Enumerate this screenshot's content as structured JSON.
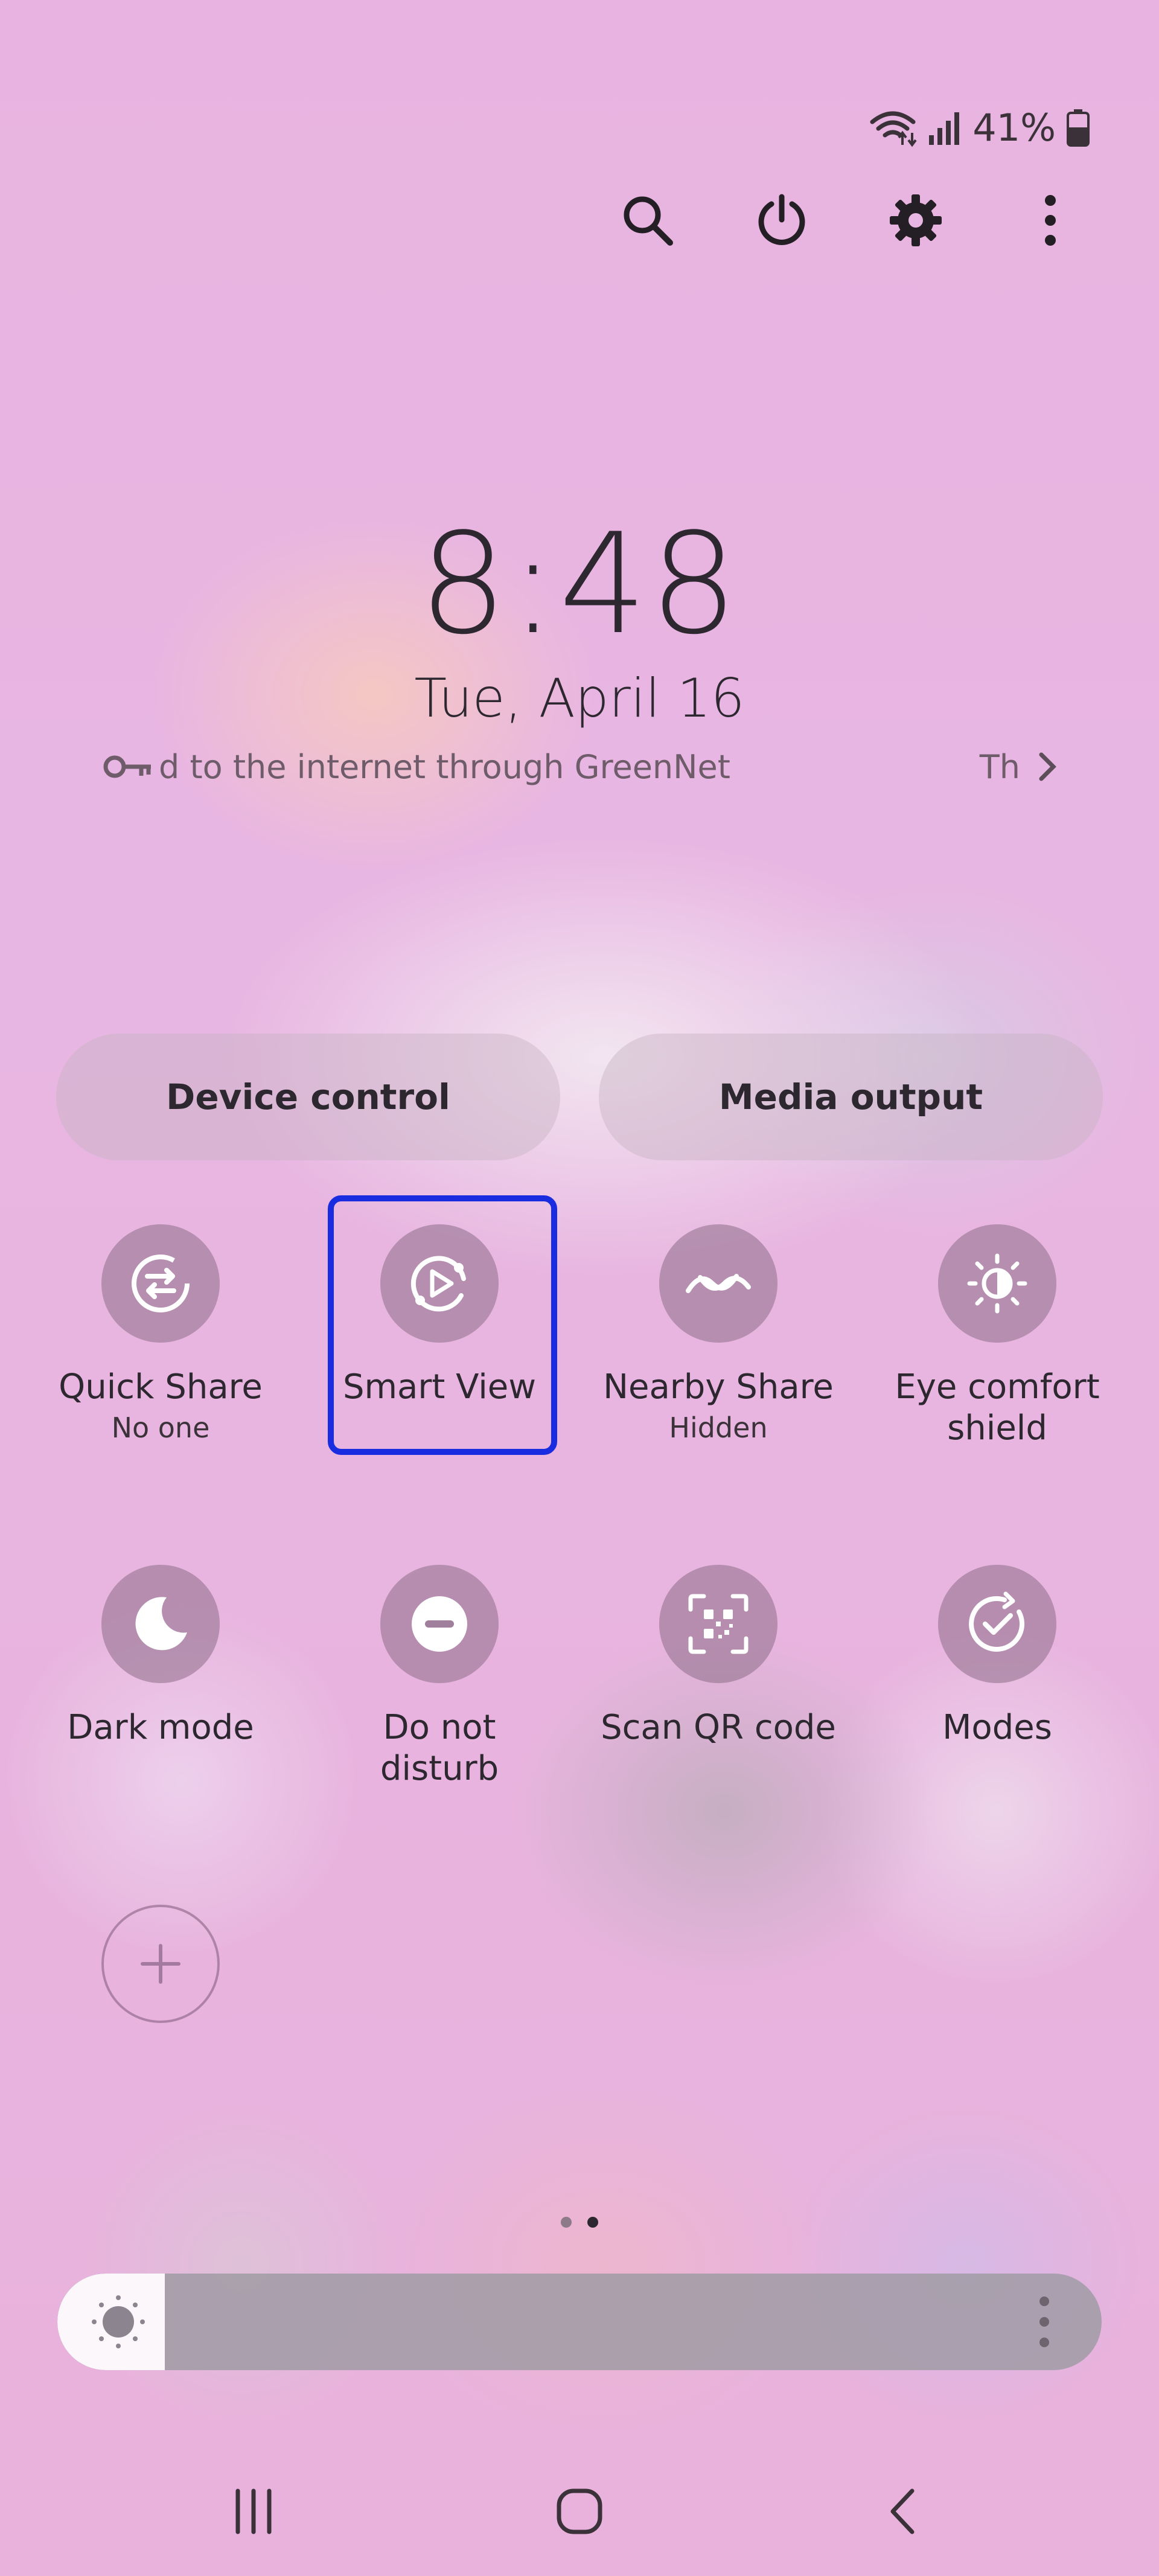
{
  "status_bar": {
    "battery_text": "41%",
    "icons": [
      "wifi-data-icon",
      "signal-icon",
      "battery-icon"
    ]
  },
  "top_actions": [
    "search-icon",
    "power-icon",
    "settings-icon",
    "more-options-icon"
  ],
  "clock": {
    "time": "8:48",
    "date": "Tue, April 16"
  },
  "network_banner": {
    "icon": "vpn-key-icon",
    "text": "d to the internet through GreenNet",
    "trailing": "Th",
    "arrow_icon": "chevron-right-icon"
  },
  "pills": {
    "device_control": "Device control",
    "media_output": "Media output"
  },
  "tiles": [
    {
      "label": "Quick Share",
      "sub": "No one",
      "icon": "quick-share-icon"
    },
    {
      "label": "Smart View",
      "sub": "",
      "icon": "smart-view-icon",
      "highlighted": true
    },
    {
      "label": "Nearby Share",
      "sub": "Hidden",
      "icon": "nearby-share-icon"
    },
    {
      "label": "Eye comfort\nshield",
      "sub": "",
      "icon": "eye-comfort-icon"
    },
    {
      "label": "Dark mode",
      "sub": "",
      "icon": "dark-mode-icon"
    },
    {
      "label": "Do not\ndisturb",
      "sub": "",
      "icon": "do-not-disturb-icon"
    },
    {
      "label": "Scan QR code",
      "sub": "",
      "icon": "qr-code-icon"
    },
    {
      "label": "Modes",
      "sub": "",
      "icon": "modes-icon"
    }
  ],
  "add_tile_icon": "plus-icon",
  "pager": {
    "pages": 2,
    "current": 2
  },
  "brightness": {
    "level": 0.04,
    "icon": "brightness-icon",
    "more_icon": "more-vertical-icon"
  },
  "nav_bar": [
    "recents-icon",
    "home-icon",
    "back-icon"
  ],
  "colors": {
    "highlight": "#1a2ce0",
    "tile_circle": "#a07f9c",
    "text": "#2d2730"
  }
}
